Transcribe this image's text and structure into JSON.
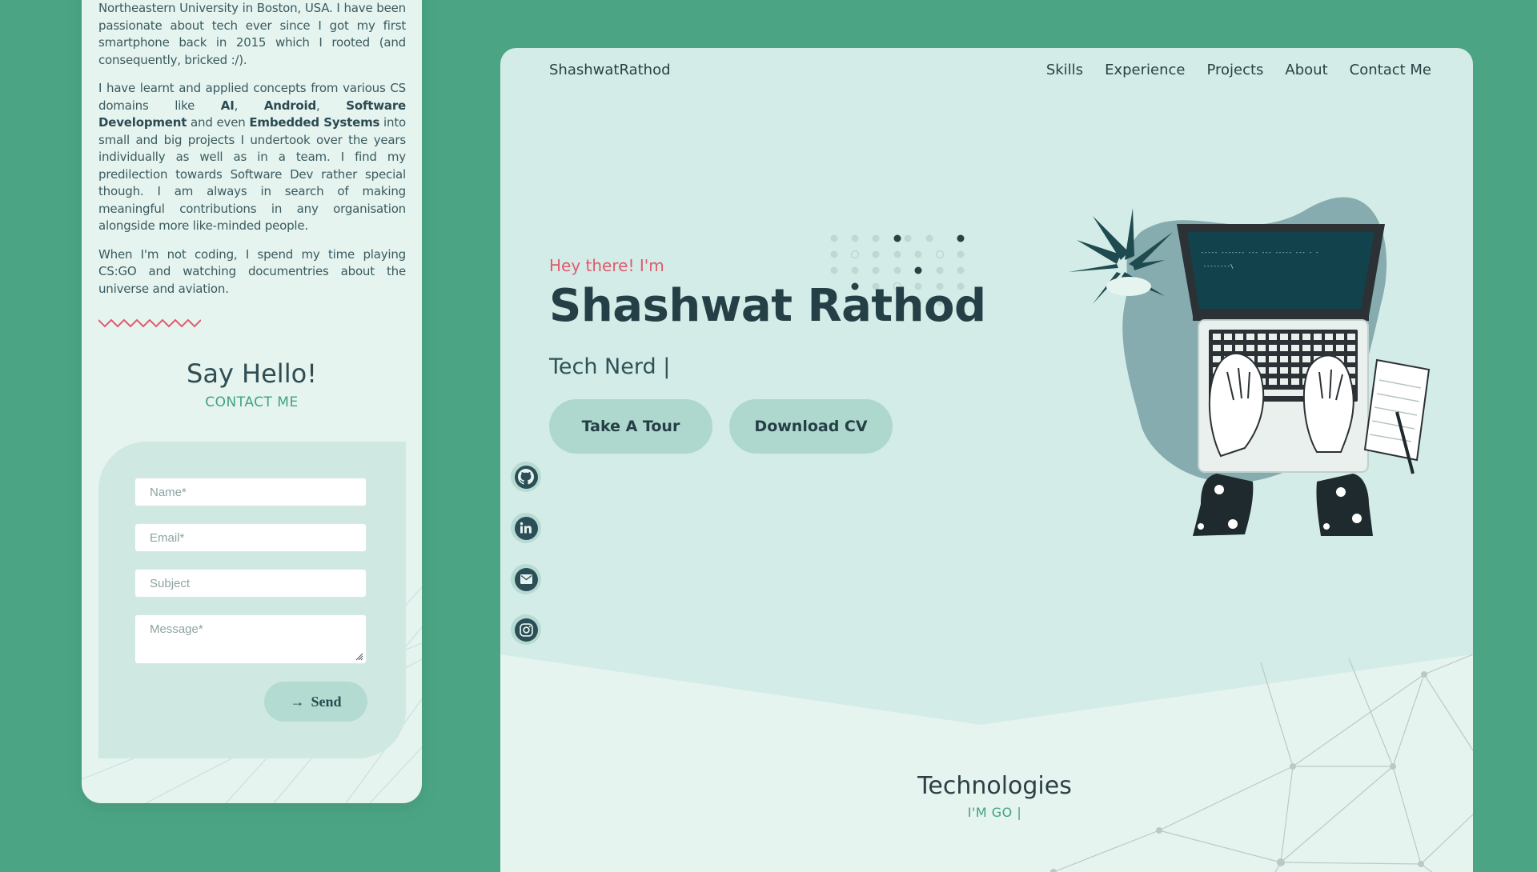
{
  "colors": {
    "background": "#4ba585",
    "panel": "#d3ece7",
    "accent_green": "#3fa37e",
    "accent_red": "#e05a6d",
    "dark_text": "#243f46",
    "button": "#aed8cd"
  },
  "mobile": {
    "bio": {
      "p1": "Northeastern University in Boston, USA. I have been passionate about tech ever since I got my first smartphone back in 2015 which I rooted (and consequently, bricked :/).",
      "p2_a": "I have learnt and applied concepts from various CS domains like ",
      "p2_ai": "AI",
      "p2_c1": ", ",
      "p2_android": "Android",
      "p2_c2": ", ",
      "p2_sd": "Software Development",
      "p2_b": " and even ",
      "p2_es": "Embedded Systems",
      "p2_c": " into small and big projects I undertook over the years individually as well as in a team. I find my predilection towards Software Dev rather special though. I am always in search of making meaningful contributions in any organisation alongside more like-minded people.",
      "p3": "When I'm not coding, I spend my time playing CS:GO and watching documentries about the universe and aviation."
    },
    "contact": {
      "title": "Say Hello!",
      "subtitle": "CONTACT ME",
      "name_placeholder": "Name*",
      "email_placeholder": "Email*",
      "subject_placeholder": "Subject",
      "message_placeholder": "Message*",
      "send_label": "Send",
      "send_icon": "arrow-right-icon"
    }
  },
  "desktop": {
    "nav": {
      "brand": "ShashwatRathod",
      "links": [
        "Skills",
        "Experience",
        "Projects",
        "About",
        "Contact Me"
      ]
    },
    "hero": {
      "greeting": "Hey there! I'm",
      "name": "Shashwat Rathod",
      "typed_text": "Tech Nerd",
      "caret": "|",
      "tour_button": "Take A Tour",
      "cv_button": "Download CV",
      "laptop_screen_line1": "----- ------- --- ---    ----- --- - -",
      "laptop_screen_line2": "--------\\"
    },
    "social": [
      "github-icon",
      "linkedin-icon",
      "email-icon",
      "instagram-icon"
    ],
    "technologies": {
      "title": "Technologies",
      "subtitle": "I'M GO",
      "caret": "|"
    }
  }
}
